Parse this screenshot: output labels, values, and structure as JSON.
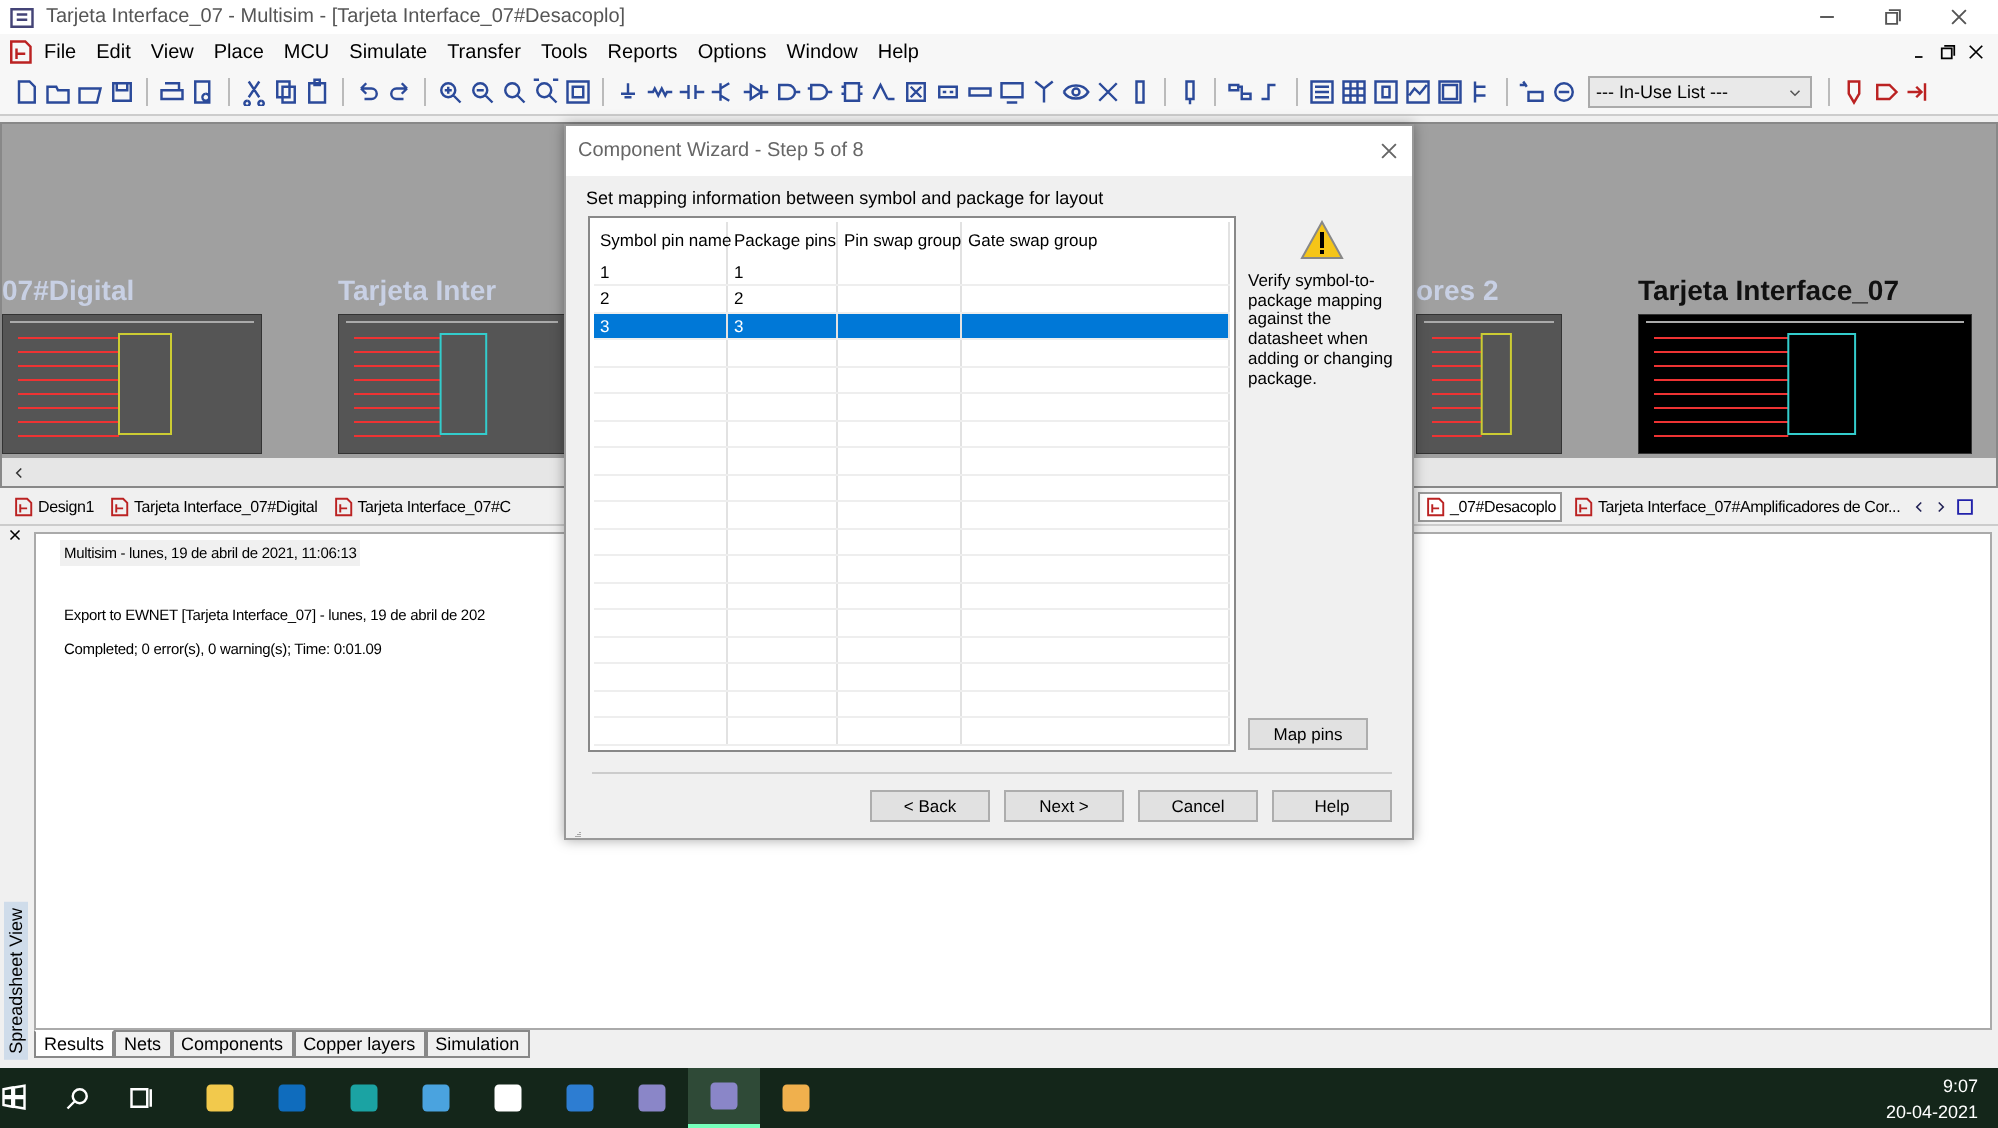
{
  "window": {
    "title": "Tarjeta Interface_07 - Multisim - [Tarjeta Interface_07#Desacoplo]"
  },
  "menu": [
    {
      "label": "File"
    },
    {
      "label": "Edit"
    },
    {
      "label": "View"
    },
    {
      "label": "Place"
    },
    {
      "label": "MCU"
    },
    {
      "label": "Simulate"
    },
    {
      "label": "Transfer"
    },
    {
      "label": "Tools"
    },
    {
      "label": "Reports"
    },
    {
      "label": "Options"
    },
    {
      "label": "Window"
    },
    {
      "label": "Help"
    }
  ],
  "toolbar": {
    "in_use_list": "--- In-Use List ---"
  },
  "workspace": {
    "sheets": [
      {
        "title": "07#Digital",
        "selected": false
      },
      {
        "title": "Tarjeta Inter",
        "selected": false
      },
      {
        "title": "ores 2",
        "selected": false
      },
      {
        "title": "Tarjeta Interface_07",
        "selected": true
      }
    ]
  },
  "design_tabs": [
    {
      "label": "Design1",
      "selected": false
    },
    {
      "label": "Tarjeta Interface_07#Digital",
      "selected": false
    },
    {
      "label": "Tarjeta Interface_07#C",
      "selected": false
    },
    {
      "label": "_07#Desacoplo",
      "selected": true
    },
    {
      "label": "Tarjeta Interface_07#Amplificadores de Cor...",
      "selected": false
    }
  ],
  "output": {
    "lines": [
      {
        "kind": "header",
        "text": "Multisim  -  lunes, 19 de abril de 2021, 11:06:13"
      },
      {
        "kind": "text",
        "text": "Export to EWNET [Tarjeta Interface_07]  - lunes, 19 de abril de 202"
      },
      {
        "kind": "text",
        "text": "Completed;  0 error(s), 0 warning(s);  Time: 0:01.09"
      }
    ]
  },
  "panel_label": "Spreadsheet View",
  "panel_tabs": [
    {
      "label": "Results",
      "selected": true
    },
    {
      "label": "Nets",
      "selected": false
    },
    {
      "label": "Components",
      "selected": false
    },
    {
      "label": "Copper layers",
      "selected": false
    },
    {
      "label": "Simulation",
      "selected": false
    }
  ],
  "dialog": {
    "title": "Component Wizard - Step 5 of 8",
    "instruction": "Set mapping information between symbol and package for layout",
    "columns": [
      "Symbol pin name",
      "Package pins",
      "Pin swap group",
      "Gate swap group"
    ],
    "rows": [
      {
        "symbol_pin_name": "1",
        "package_pins": "1",
        "selected": false
      },
      {
        "symbol_pin_name": "2",
        "package_pins": "2",
        "selected": false
      },
      {
        "symbol_pin_name": "3",
        "package_pins": "3",
        "selected": true
      }
    ],
    "note": "Verify symbol-to-package mapping against the datasheet when adding or changing package.",
    "map_button": "Map pins",
    "buttons": [
      "< Back",
      "Next >",
      "Cancel",
      "Help"
    ]
  },
  "taskbar": {
    "apps": [
      {
        "selected": false
      },
      {
        "selected": false
      },
      {
        "selected": false
      },
      {
        "selected": false
      },
      {
        "selected": false
      },
      {
        "selected": false
      },
      {
        "selected": false
      },
      {
        "selected": true
      },
      {
        "selected": false
      }
    ],
    "time": "9:07",
    "date": "20-04-2021"
  }
}
